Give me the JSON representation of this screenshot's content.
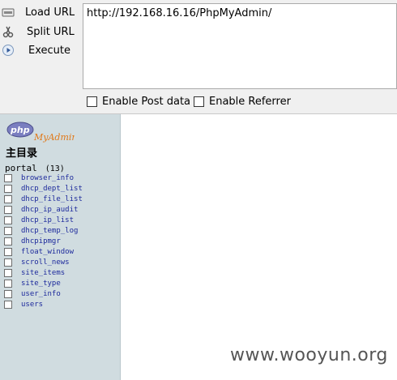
{
  "toolbar": {
    "load_url": "Load URL",
    "split_url": "Split URL",
    "execute": "Execute",
    "url_value": "http://192.168.16.16/PhpMyAdmin/",
    "enable_post": "Enable Post data",
    "enable_referrer": "Enable Referrer"
  },
  "sidebar": {
    "logo_php": "php",
    "logo_myadmin": "MyAdmin",
    "main_dir": "主目录",
    "db_name": "portal",
    "db_count": "(13)",
    "tables": [
      "browser_info",
      "dhcp_dept_list",
      "dhcp_file_list",
      "dhcp_ip_audit",
      "dhcp_ip_list",
      "dhcp_temp_log",
      "dhcpipmgr",
      "float_window",
      "scroll_news",
      "site_items",
      "site_type",
      "user_info",
      "users"
    ]
  },
  "watermark": "www.wooyun.org"
}
